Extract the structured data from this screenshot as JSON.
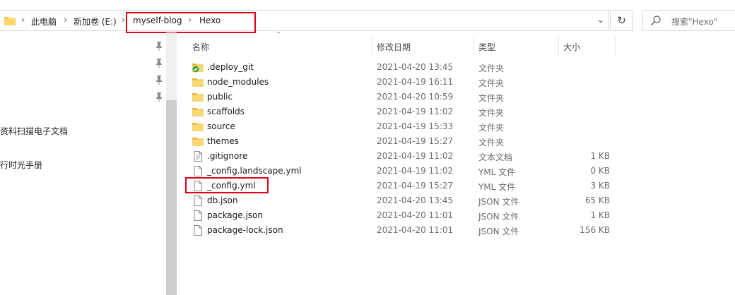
{
  "address": {
    "path": [
      "此电脑",
      "新加卷 (E:)",
      "myself-blog",
      "Hexo"
    ]
  },
  "search": {
    "placeholder": "搜索\"Hexo\""
  },
  "nav": {
    "items": [
      "资料扫描电子文档",
      "行时光手册"
    ]
  },
  "columns": {
    "name": "名称",
    "date": "修改日期",
    "type": "类型",
    "size": "大小"
  },
  "files": [
    {
      "name": ".deploy_git",
      "date": "2021-04-20 13:45",
      "type": "文件夹",
      "size": "",
      "icon": "folder-sync-icon"
    },
    {
      "name": "node_modules",
      "date": "2021-04-19 16:11",
      "type": "文件夹",
      "size": "",
      "icon": "folder-icon"
    },
    {
      "name": "public",
      "date": "2021-04-20 10:59",
      "type": "文件夹",
      "size": "",
      "icon": "folder-icon"
    },
    {
      "name": "scaffolds",
      "date": "2021-04-19 11:02",
      "type": "文件夹",
      "size": "",
      "icon": "folder-icon"
    },
    {
      "name": "source",
      "date": "2021-04-19 15:33",
      "type": "文件夹",
      "size": "",
      "icon": "folder-icon"
    },
    {
      "name": "themes",
      "date": "2021-04-19 15:27",
      "type": "文件夹",
      "size": "",
      "icon": "folder-icon"
    },
    {
      "name": ".gitignore",
      "date": "2021-04-19 11:02",
      "type": "文本文档",
      "size": "1 KB",
      "icon": "text-file-icon"
    },
    {
      "name": "_config.landscape.yml",
      "date": "2021-04-19 11:02",
      "type": "YML 文件",
      "size": "0 KB",
      "icon": "file-icon"
    },
    {
      "name": "_config.yml",
      "date": "2021-04-19 15:27",
      "type": "YML 文件",
      "size": "3 KB",
      "icon": "file-icon"
    },
    {
      "name": "db.json",
      "date": "2021-04-20 13:45",
      "type": "JSON 文件",
      "size": "65 KB",
      "icon": "file-icon"
    },
    {
      "name": "package.json",
      "date": "2021-04-20 11:01",
      "type": "JSON 文件",
      "size": "1 KB",
      "icon": "file-icon"
    },
    {
      "name": "package-lock.json",
      "date": "2021-04-20 11:01",
      "type": "JSON 文件",
      "size": "156 KB",
      "icon": "file-icon"
    }
  ],
  "colors": {
    "highlight": "#e0001a",
    "folder": "#f5c542",
    "sync": "#3aa335"
  }
}
